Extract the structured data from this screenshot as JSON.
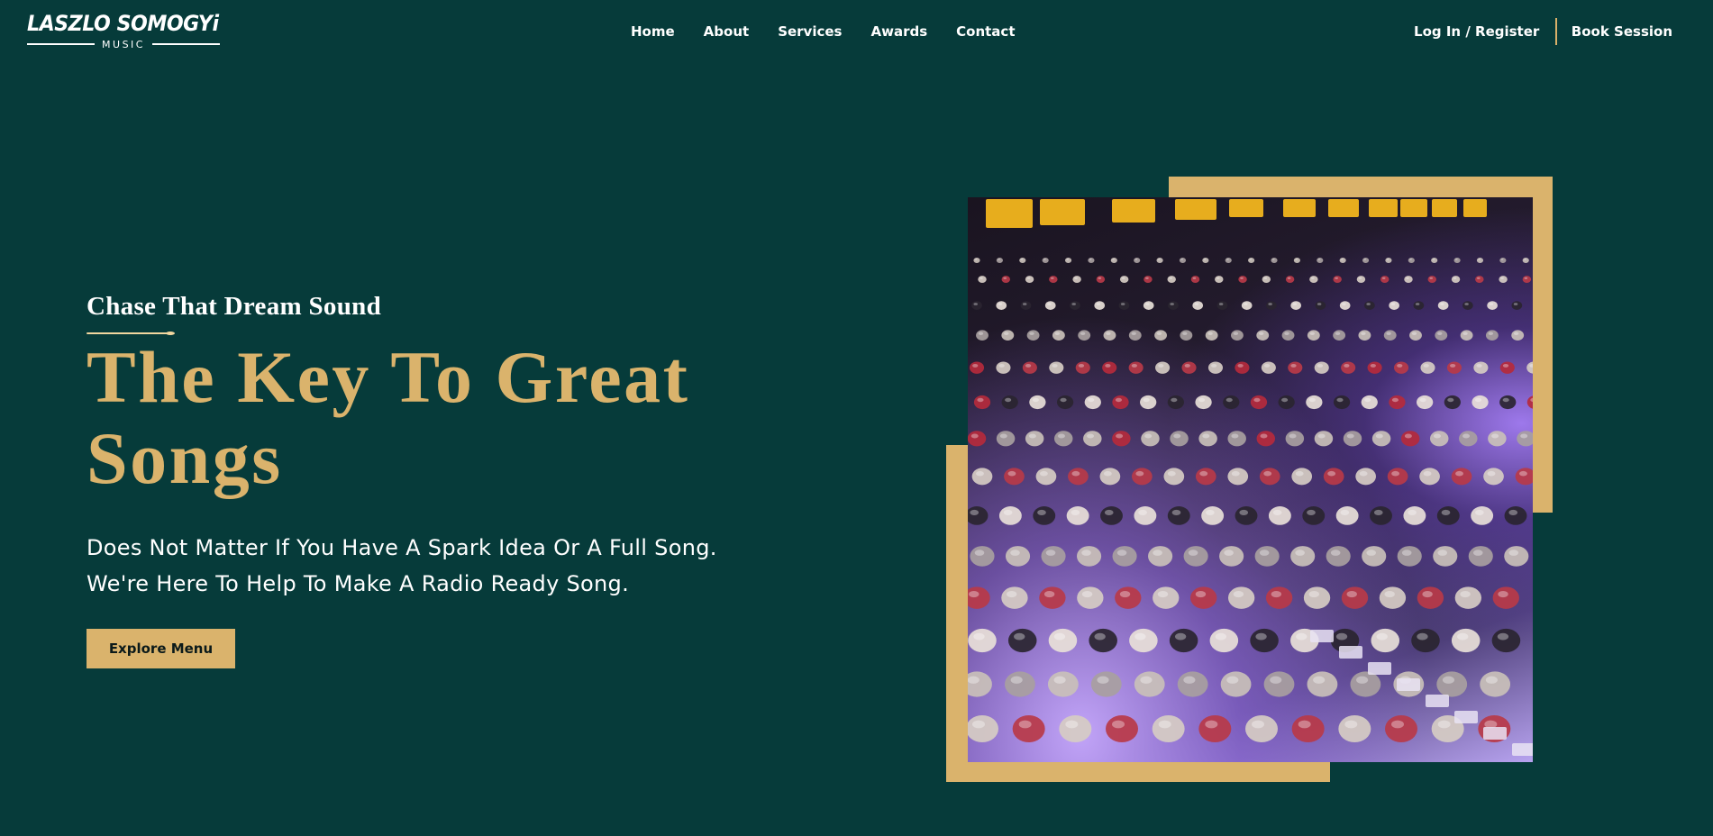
{
  "brand": {
    "name": "LASZLO SOMOGYi",
    "sub": "MUSIC"
  },
  "nav": {
    "items": [
      "Home",
      "About",
      "Services",
      "Awards",
      "Contact"
    ]
  },
  "header_right": {
    "login": "Log In / Register",
    "book": "Book Session"
  },
  "hero": {
    "tagline": "Chase That Dream Sound",
    "headline": "The Key To Great Songs",
    "description_line1": "Does Not Matter If You Have A Spark Idea Or A Full Song.",
    "description_line2": "We're Here To Help To Make A Radio Ready Song.",
    "cta": "Explore Menu",
    "image_subject": "mixing-console-photo"
  },
  "colors": {
    "background": "#063b3a",
    "accent": "#dab36c",
    "text": "#ffffff"
  }
}
